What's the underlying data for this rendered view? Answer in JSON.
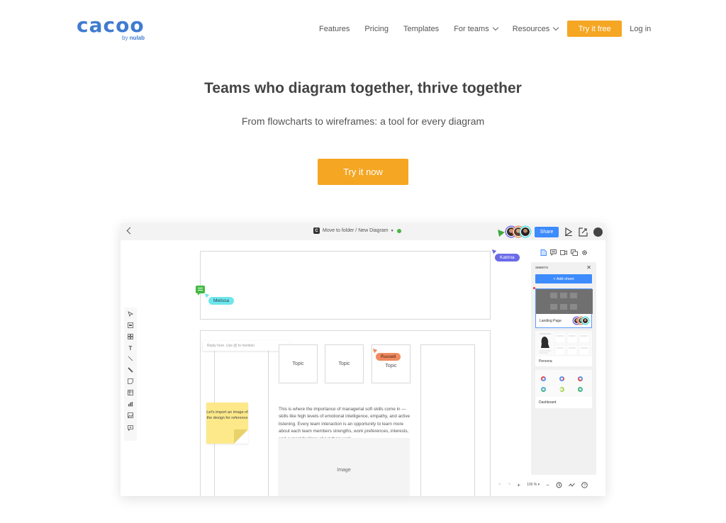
{
  "nav": {
    "logo_word": "cacoo",
    "logo_sub_prefix": "by",
    "logo_sub_brand": "nulab",
    "links": [
      {
        "label": "Features",
        "dropdown": false
      },
      {
        "label": "Pricing",
        "dropdown": false
      },
      {
        "label": "Templates",
        "dropdown": false
      },
      {
        "label": "For teams",
        "dropdown": true
      },
      {
        "label": "Resources",
        "dropdown": true
      }
    ],
    "try_free_label": "Try it free",
    "login_label": "Log in"
  },
  "hero": {
    "title": "Teams who diagram together, thrive together",
    "subtitle": "From flowcharts to wireframes: a tool for every diagram",
    "cta_label": "Try it now"
  },
  "app": {
    "breadcrumb": "Move to folder / New Diagram",
    "breadcrumb_badge": "C",
    "share_label": "Share",
    "canvas": {
      "reply_placeholder": "Reply here. Use @ to mention",
      "topics": [
        "Topic",
        "Topic",
        "Topic"
      ],
      "paragraph": "This is where the importance of managerial soft skills come in — skills like high levels of emotional intelligence, empathy, and active listening. Every team interaction is an opportunity to learn more about each team members strengths, work preferences, interests, and current feelings about their work.",
      "image_label": "Image",
      "sticky_note": "Let's import an image of the design for reference",
      "collaborators": [
        {
          "name": "Melissa",
          "color": "#6fe6ec"
        },
        {
          "name": "Katrina",
          "color": "#6a6ae8"
        },
        {
          "name": "Russell",
          "color": "#f08a60"
        }
      ]
    },
    "sheets_panel": {
      "title": "SHEETS",
      "add_label": "+ Add sheet",
      "sheets": [
        {
          "name": "Landing Page",
          "active": true
        },
        {
          "name": "Persona",
          "active": false
        },
        {
          "name": "Dashboard",
          "active": false
        }
      ]
    },
    "bottom_bar": {
      "zoom": "100 %"
    }
  },
  "colors": {
    "brand_blue": "#3f7bd0",
    "cta_orange": "#f5a623",
    "share_blue": "#3d8bfd"
  }
}
